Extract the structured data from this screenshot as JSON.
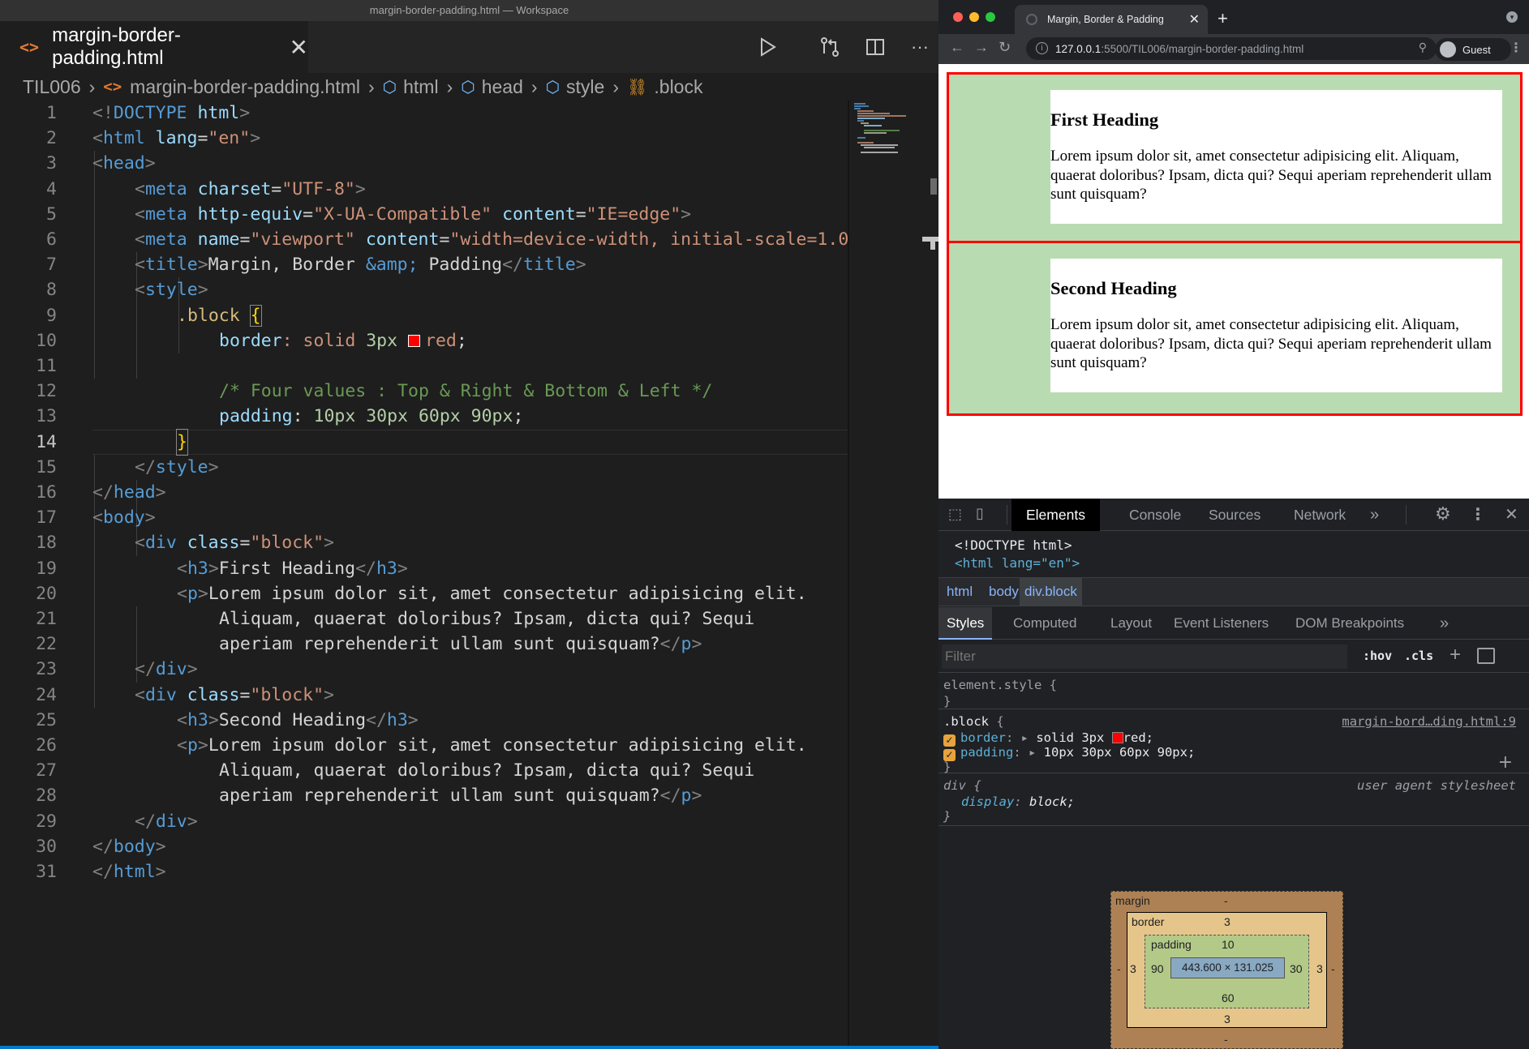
{
  "vscode": {
    "window_title": "margin-border-padding.html — Workspace",
    "tab": {
      "icon": "html-file-icon",
      "label": "margin-border-padding.html"
    },
    "breadcrumb": [
      "TIL006",
      "margin-border-padding.html",
      "html",
      "head",
      "style",
      ".block"
    ],
    "current_line": 14,
    "swatch_color": "#ff0000",
    "line_numbers": [
      "1",
      "2",
      "3",
      "4",
      "5",
      "6",
      "7",
      "8",
      "9",
      "10",
      "11",
      "12",
      "13",
      "14",
      "15",
      "16",
      "17",
      "18",
      "19",
      "20",
      "21",
      "22",
      "23",
      "24",
      "25",
      "26",
      "27",
      "28",
      "29",
      "30",
      "31"
    ],
    "code": {
      "l1a": "<!",
      "l1b": "DOCTYPE",
      "l1c": " html",
      "l1d": ">",
      "l2a": "<",
      "l2b": "html",
      "l2c": " lang",
      "l2d": "=",
      "l2e": "\"en\"",
      "l2f": ">",
      "l3a": "<",
      "l3b": "head",
      "l3c": ">",
      "l4a": "<",
      "l4b": "meta",
      "l4c": " charset",
      "l4d": "=",
      "l4e": "\"UTF-8\"",
      "l4f": ">",
      "l5a": "<",
      "l5b": "meta",
      "l5c": " http-equiv",
      "l5d": "=",
      "l5e": "\"X-UA-Compatible\"",
      "l5f": " content",
      "l5g": "=",
      "l5h": "\"IE=edge\"",
      "l5i": ">",
      "l6a": "<",
      "l6b": "meta",
      "l6c": " name",
      "l6d": "=",
      "l6e": "\"viewport\"",
      "l6f": " content",
      "l6g": "=",
      "l6h": "\"width=device-width, initial-scale=1.0\"",
      "l6i": ">",
      "l7a": "<",
      "l7b": "title",
      "l7c": ">",
      "l7d": "Margin, Border ",
      "l7e": "&amp;",
      "l7f": " Padding",
      "l7g": "</",
      "l7h": "title",
      "l7i": ">",
      "l8a": "<",
      "l8b": "style",
      "l8c": ">",
      "l9a": ".block",
      "l9b": " ",
      "l9c": "{",
      "l10a": "border",
      "l10b": ": solid ",
      "l10c": "3px",
      "l10d": " ",
      "l10e": "red",
      "l10f": ";",
      "l12": "/* Four values : Top & Right & Bottom & Left */",
      "l13a": "padding",
      "l13b": ": ",
      "l13c": "10px 30px 60px 90px",
      "l13d": ";",
      "l14": "}",
      "l15a": "</",
      "l15b": "style",
      "l15c": ">",
      "l16a": "</",
      "l16b": "head",
      "l16c": ">",
      "l17a": "<",
      "l17b": "body",
      "l17c": ">",
      "l18a": "<",
      "l18b": "div",
      "l18c": " class",
      "l18d": "=",
      "l18e": "\"block\"",
      "l18f": ">",
      "l19a": "<",
      "l19b": "h3",
      "l19c": ">",
      "l19d": "First Heading",
      "l19e": "</",
      "l19f": "h3",
      "l19g": ">",
      "l20a": "<",
      "l20b": "p",
      "l20c": ">",
      "l20d": "Lorem ipsum dolor sit, amet consectetur adipisicing elit.",
      "l21": "Aliquam, quaerat doloribus? Ipsam, dicta qui? Sequi",
      "l22a": "aperiam reprehenderit ullam sunt quisquam?",
      "l22b": "</",
      "l22c": "p",
      "l22d": ">",
      "l23a": "</",
      "l23b": "div",
      "l23c": ">",
      "l24a": "<",
      "l24b": "div",
      "l24c": " class",
      "l24d": "=",
      "l24e": "\"block\"",
      "l24f": ">",
      "l25a": "<",
      "l25b": "h3",
      "l25c": ">",
      "l25d": "Second Heading",
      "l25e": "</",
      "l25f": "h3",
      "l25g": ">",
      "l26a": "<",
      "l26b": "p",
      "l26c": ">",
      "l26d": "Lorem ipsum dolor sit, amet consectetur adipisicing elit.",
      "l27": "Aliquam, quaerat doloribus? Ipsam, dicta qui? Sequi",
      "l28a": "aperiam reprehenderit ullam sunt quisquam?",
      "l28b": "</",
      "l28c": "p",
      "l28d": ">",
      "l29a": "</",
      "l29b": "div",
      "l29c": ">",
      "l30a": "</",
      "l30b": "body",
      "l30c": ">",
      "l31a": "</",
      "l31b": "html",
      "l31c": ">"
    }
  },
  "browser": {
    "tab_title": "Margin, Border & Padding",
    "url_host": "127.0.0.1",
    "url_path": ":5500/TIL006/margin-border-padding.html",
    "profile_label": "Guest",
    "page": {
      "blocks": [
        {
          "heading": "First Heading",
          "text": "Lorem ipsum dolor sit, amet consectetur adipisicing elit. Aliquam, quaerat doloribus? Ipsam, dicta qui? Sequi aperiam reprehenderit ullam sunt quisquam?"
        },
        {
          "heading": "Second Heading",
          "text": "Lorem ipsum dolor sit, amet consectetur adipisicing elit. Aliquam, quaerat doloribus? Ipsam, dicta qui? Sequi aperiam reprehenderit ullam sunt quisquam?"
        }
      ],
      "border_color": "#ff0000",
      "padding_color": "#b9dbb2"
    }
  },
  "devtools": {
    "tabs": [
      "Elements",
      "Console",
      "Sources",
      "Network"
    ],
    "more": "»",
    "html_lines": {
      "doctype": "<!DOCTYPE html>",
      "html_open": "<html lang=\"en\">"
    },
    "crumbs": [
      "html",
      "body",
      "div.block"
    ],
    "subtabs": [
      "Styles",
      "Computed",
      "Layout",
      "Event Listeners",
      "DOM Breakpoints"
    ],
    "filter_placeholder": "Filter",
    "hov": ":hov",
    "cls": ".cls",
    "rules": {
      "element_style": "element.style {",
      "close": "}",
      "block_selector": ".block",
      "block_open": " {",
      "block_source": "margin-bord…ding.html:9",
      "border_prop": "border",
      "border_val_a": "solid 3px",
      "border_val_b": "red;",
      "padding_prop": "padding",
      "padding_val": "10px 30px 60px 90px;",
      "div_selector": "div",
      "div_open": " {",
      "div_source": "user agent stylesheet",
      "display_prop": "display",
      "display_val": "block;"
    },
    "box_model": {
      "margin_label": "margin",
      "margin_top": "-",
      "margin_left": "-",
      "margin_right": "-",
      "margin_bottom": "-",
      "border_label": "border",
      "border_top": "3",
      "border_left": "3",
      "border_right": "3",
      "border_bottom": "3",
      "padding_label": "padding",
      "padding_top": "10",
      "padding_left": "90",
      "padding_right": "30",
      "padding_bottom": "60",
      "content": "443.600 × 131.025"
    }
  }
}
